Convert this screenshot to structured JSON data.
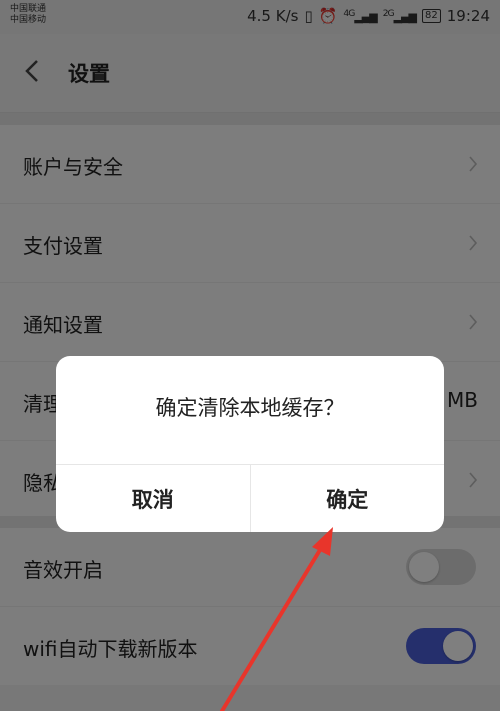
{
  "status_bar": {
    "carrier_1": "中国联通",
    "carrier_2": "中国移动",
    "speed": "4.5 K/s",
    "signal_1_label": "4G",
    "signal_2_label": "2G",
    "battery": "82",
    "time": "19:24"
  },
  "header": {
    "back_icon": "chevron-left-icon",
    "title": "设置"
  },
  "settings": {
    "group1": [
      {
        "label": "账户与安全"
      },
      {
        "label": "支付设置"
      },
      {
        "label": "通知设置"
      },
      {
        "label": "清理缓存",
        "value": "MB"
      },
      {
        "label": "隐私设置"
      }
    ],
    "group2": [
      {
        "label": "音效开启",
        "toggle": "off"
      },
      {
        "label": "wifi自动下载新版本",
        "toggle": "on"
      }
    ]
  },
  "dialog": {
    "message": "确定清除本地缓存？",
    "cancel_label": "取消",
    "confirm_label": "确定"
  },
  "colors": {
    "toggle_on": "#4a5fd8",
    "toggle_off": "#d8d8d8",
    "annotation_arrow": "#e8352b"
  }
}
